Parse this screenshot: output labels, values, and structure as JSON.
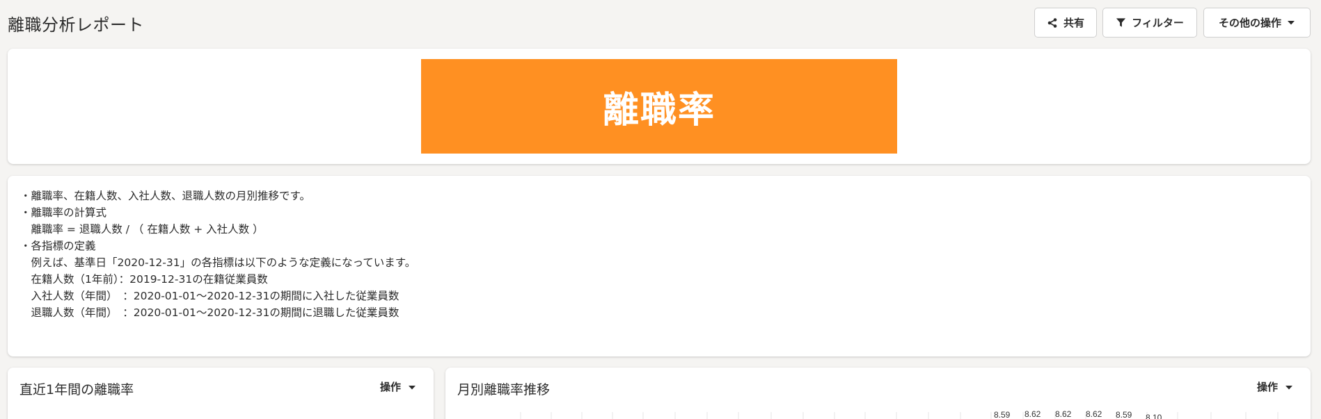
{
  "header": {
    "title": "離職分析レポート",
    "share_label": "共有",
    "filter_label": "フィルター",
    "more_label": "その他の操作"
  },
  "banner": {
    "text": "離職率",
    "color": "#ff9022"
  },
  "description": {
    "lines": [
      "・離職率、在籍人数、入社人数、退職人数の月別推移です。",
      "・離職率の計算式",
      "　離職率 = 退職人数 / （ 在籍人数 + 入社人数 ）",
      "・各指標の定義",
      "　例えば、基準日「2020-12-31」の各指標は以下のような定義になっています。",
      "　在籍人数（1年前）：2019-12-31の在籍従業員数",
      "　入社人数（年間）　：2020-01-01～2020-12-31の期間に入社した従業員数",
      "　退職人数（年間）　：2020-01-01～2020-12-31の期間に退職した従業員数"
    ]
  },
  "panels": {
    "left": {
      "title": "直近1年間の離職率",
      "action_label": "操作"
    },
    "right": {
      "title": "月別離職率推移",
      "action_label": "操作",
      "visible_labels": [
        "8.59",
        "8.62",
        "8.62",
        "8.62",
        "8.59",
        "8.10"
      ]
    }
  }
}
